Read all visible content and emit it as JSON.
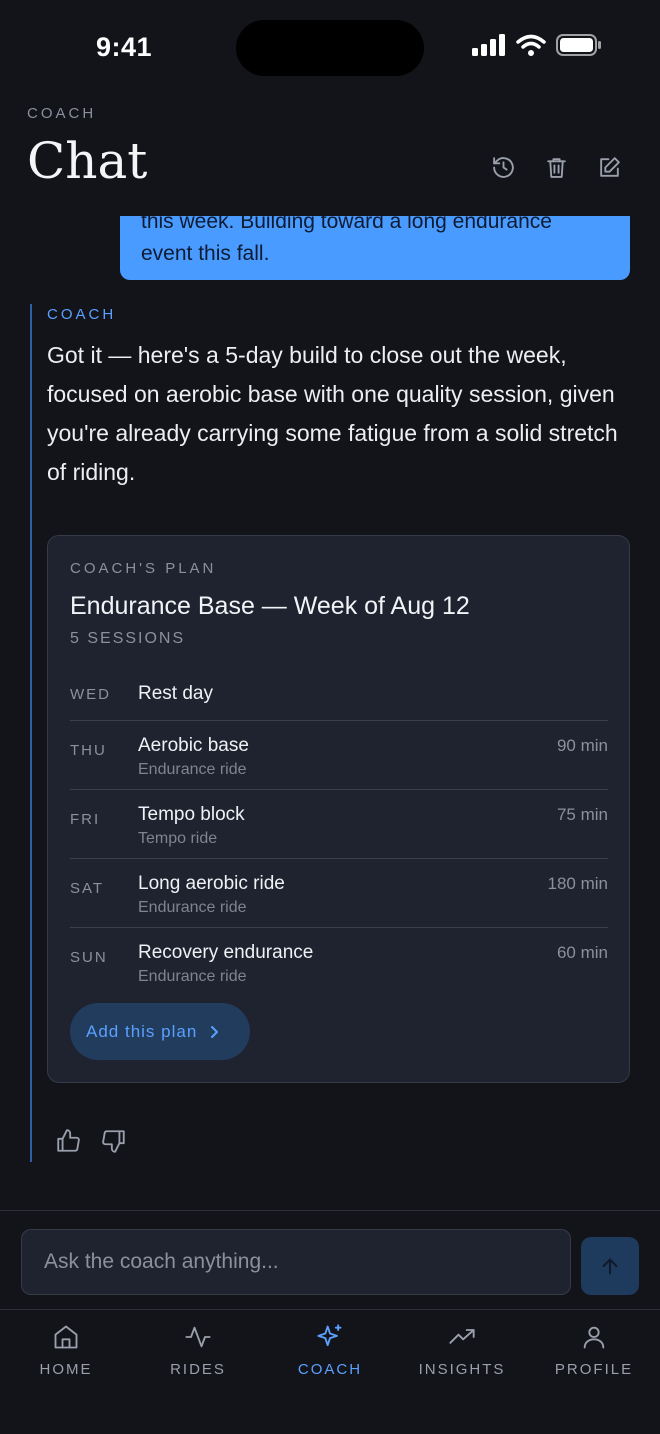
{
  "status_bar": {
    "time": "9:41"
  },
  "header": {
    "overline": "COACH",
    "title": "Chat"
  },
  "chat": {
    "user_message": "this week. Building toward a long endurance event this fall.",
    "coach_label": "COACH",
    "coach_message": "Got it — here's a 5-day build to close out the week, focused on aerobic base with one quality session, given you're already carrying some fatigue from a solid stretch of riding.",
    "plan": {
      "overline": "COACH'S PLAN",
      "title": "Endurance Base — Week of Aug 12",
      "count": "5 SESSIONS",
      "sessions": [
        {
          "day": "WED",
          "name": "Rest day",
          "type": "",
          "duration": ""
        },
        {
          "day": "THU",
          "name": "Aerobic base",
          "type": "Endurance ride",
          "duration": "90 min"
        },
        {
          "day": "FRI",
          "name": "Tempo block",
          "type": "Tempo ride",
          "duration": "75 min"
        },
        {
          "day": "SAT",
          "name": "Long aerobic ride",
          "type": "Endurance ride",
          "duration": "180 min"
        },
        {
          "day": "SUN",
          "name": "Recovery endurance",
          "type": "Endurance ride",
          "duration": "60 min"
        }
      ],
      "add_label": "Add this plan"
    }
  },
  "composer": {
    "placeholder": "Ask the coach anything..."
  },
  "tabs": [
    {
      "label": "HOME",
      "icon": "home-icon"
    },
    {
      "label": "RIDES",
      "icon": "activity-icon"
    },
    {
      "label": "COACH",
      "icon": "sparkle-icon",
      "active": true
    },
    {
      "label": "INSIGHTS",
      "icon": "trend-icon"
    },
    {
      "label": "PROFILE",
      "icon": "user-icon"
    }
  ],
  "colors": {
    "accent": "#5aa0ff",
    "user_bubble": "#4a9bff",
    "background": "#12141a",
    "card": "#1f2330"
  }
}
